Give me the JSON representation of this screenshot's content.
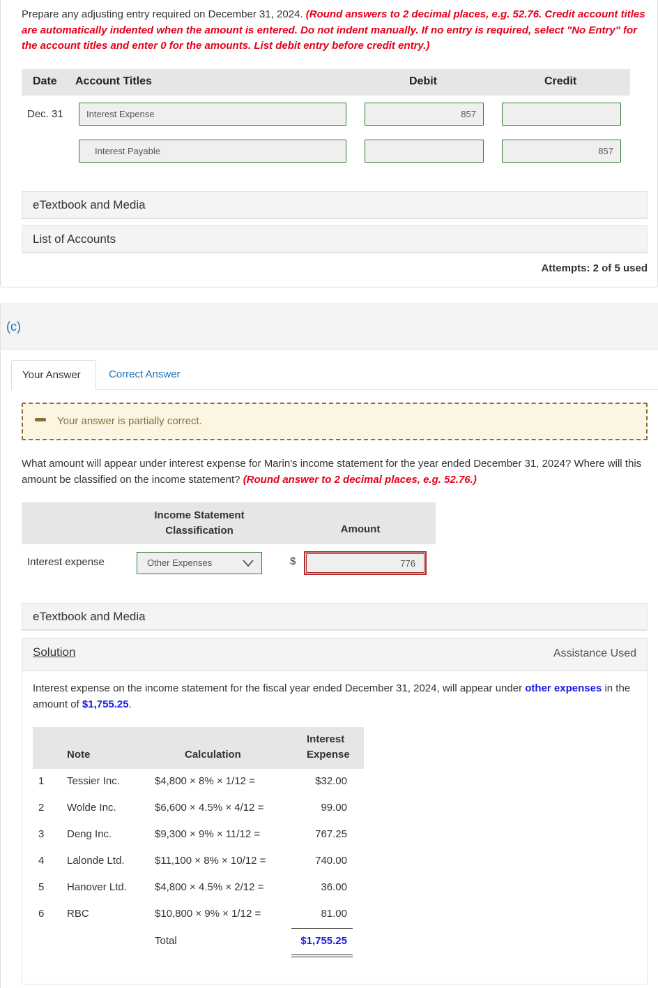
{
  "part_b": {
    "instruction_plain": "Prepare any adjusting entry required on December 31, 2024.",
    "instruction_red": "(Round answers to 2 decimal places, e.g. 52.76. Credit account titles are automatically indented when the amount is entered. Do not indent manually. If no entry is required, select \"No Entry\" for the account titles and enter 0 for the amounts. List debit entry before credit entry.)",
    "table_headers": {
      "date": "Date",
      "account_titles": "Account Titles",
      "debit": "Debit",
      "credit": "Credit"
    },
    "entries": [
      {
        "date": "Dec. 31",
        "account": "Interest Expense",
        "debit": "857",
        "credit": ""
      },
      {
        "date": "",
        "account": "Interest Payable",
        "debit": "",
        "credit": "857"
      }
    ],
    "etextbook_label": "eTextbook and Media",
    "list_of_accounts_label": "List of Accounts",
    "attempts": "Attempts: 2 of 5 used"
  },
  "part_c": {
    "section_label": "(c)",
    "tabs": [
      {
        "label": "Your Answer",
        "active": true
      },
      {
        "label": "Correct Answer",
        "active": false
      }
    ],
    "status_message": "Your answer is partially correct.",
    "question_plain": "What amount will appear under interest expense for Marin's income statement for the year ended December 31, 2024? Where will this amount be classified on the income statement?",
    "question_red": "(Round answer to 2 decimal places, e.g. 52.76.)",
    "table_headers": {
      "classification": "Income Statement Classification",
      "amount": "Amount"
    },
    "row_label": "Interest expense",
    "classification_selected": "Other Expenses",
    "currency_symbol": "$",
    "amount_value": "776",
    "etextbook_label": "eTextbook and Media",
    "solution": {
      "title": "Solution",
      "assistance": "Assistance Used",
      "text_before": "Interest expense on the income statement for the fiscal year ended December 31, 2024, will appear under ",
      "text_highlight1": "other expenses",
      "text_middle": " in the amount of ",
      "text_highlight2": "$1,755.25",
      "text_after": ".",
      "table_headers": {
        "note": "Note",
        "calculation": "Calculation",
        "interest_expense_line1": "Interest",
        "interest_expense_line2": "Expense"
      },
      "rows": [
        {
          "n": "1",
          "name": "Tessier Inc.",
          "calc": "$4,800 × 8% × 1/12 =",
          "amount": "$32.00"
        },
        {
          "n": "2",
          "name": "Wolde Inc.",
          "calc": "$6,600 × 4.5% × 4/12 =",
          "amount": "99.00"
        },
        {
          "n": "3",
          "name": "Deng Inc.",
          "calc": "$9,300 × 9% × 11/12 =",
          "amount": "767.25"
        },
        {
          "n": "4",
          "name": "Lalonde Ltd.",
          "calc": "$11,100 × 8% × 10/12 =",
          "amount": "740.00"
        },
        {
          "n": "5",
          "name": "Hanover Ltd.",
          "calc": "$4,800 × 4.5% × 2/12 =",
          "amount": "36.00"
        },
        {
          "n": "6",
          "name": "RBC",
          "calc": "$10,800 × 9% × 1/12 =",
          "amount": "81.00"
        }
      ],
      "total_label": "Total",
      "total_amount": "$1,755.25"
    }
  },
  "colors": {
    "instruction_red": "#e5001a",
    "link_blue": "#1a73b5",
    "solution_blue": "#1a1ae6",
    "correct_border": "#2e7d32",
    "incorrect_border": "#b03030",
    "partial_bg": "#fcf5e2",
    "partial_fg": "#8a6d3b"
  }
}
